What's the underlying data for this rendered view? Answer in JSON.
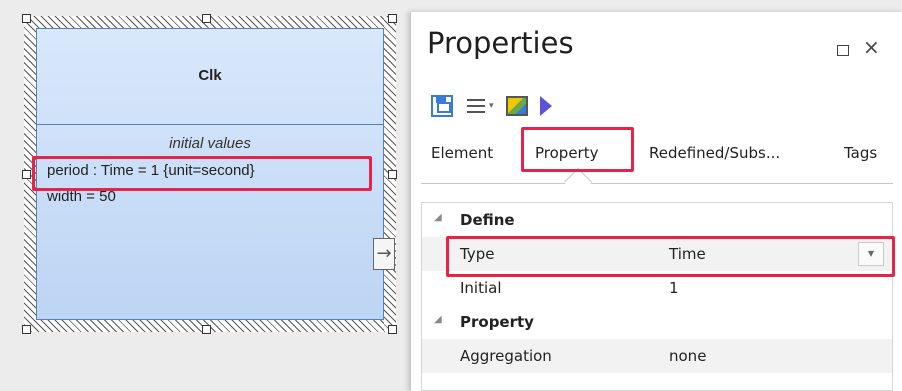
{
  "diagram": {
    "block": {
      "name": "Clk",
      "compartment_heading": "initial values",
      "values": [
        "period : Time = 1 {unit=second}",
        "width = 50"
      ]
    },
    "port_icon": "arrow-right-icon"
  },
  "properties_panel": {
    "title": "Properties",
    "window_buttons": {
      "restore_icon": "restore-window-icon",
      "close_glyph": "×"
    },
    "toolbar": [
      "save-icon",
      "menu-icon",
      "dropdown-caret-icon",
      "image-icon",
      "run-icon"
    ],
    "tabs": [
      {
        "label": "Element"
      },
      {
        "label": "Property",
        "selected": true
      },
      {
        "label": "Redefined/Subs..."
      },
      {
        "label": "Tags"
      }
    ],
    "grid": {
      "sections": [
        {
          "name": "Define",
          "rows": [
            {
              "label": "Type",
              "value": "Time",
              "has_dropdown": true,
              "highlighted": true
            },
            {
              "label": "Initial",
              "value": "1"
            }
          ]
        },
        {
          "name": "Property",
          "rows": [
            {
              "label": "Aggregation",
              "value": "none"
            }
          ]
        }
      ]
    }
  },
  "highlight_color": "#e8234a"
}
